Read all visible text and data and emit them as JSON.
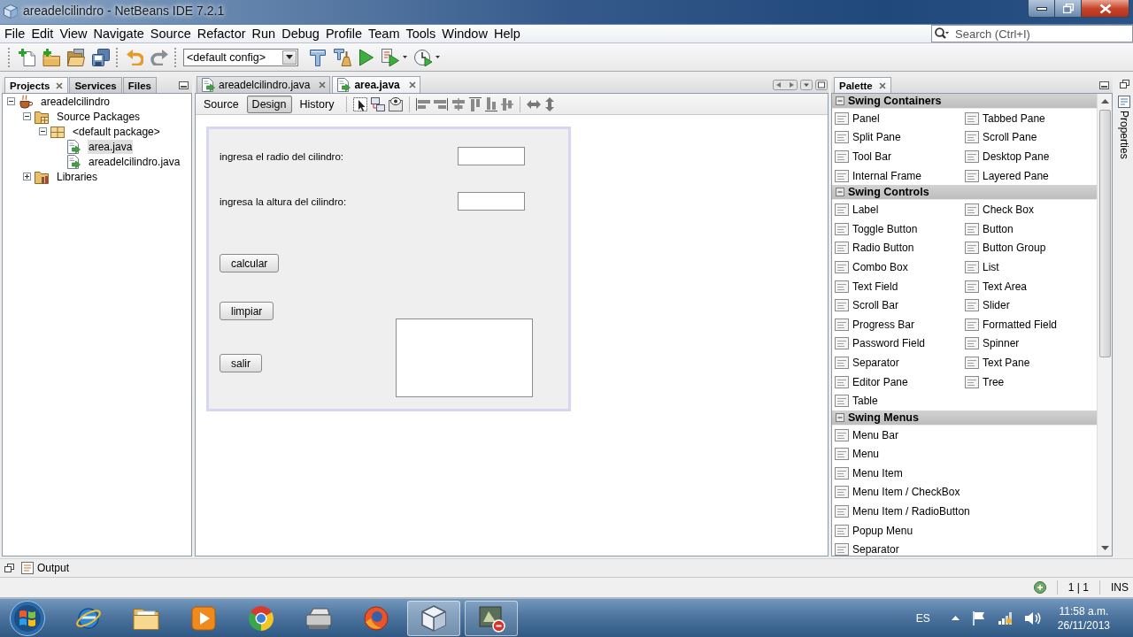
{
  "window": {
    "title": "areadelcilindro - NetBeans IDE 7.2.1"
  },
  "menu_bar": [
    "File",
    "Edit",
    "View",
    "Navigate",
    "Source",
    "Refactor",
    "Run",
    "Debug",
    "Profile",
    "Team",
    "Tools",
    "Window",
    "Help"
  ],
  "search": {
    "placeholder": "Search (Ctrl+I)"
  },
  "toolbar": {
    "configuration": "<default config>"
  },
  "projects_panel": {
    "tabs": [
      {
        "label": "Projects",
        "selected": true
      },
      {
        "label": "Services",
        "selected": false
      },
      {
        "label": "Files",
        "selected": false
      }
    ],
    "tree": [
      {
        "label": "areadelcilindro",
        "kind": "project",
        "expanded": true,
        "selected": false,
        "children": [
          {
            "label": "Source Packages",
            "kind": "sources",
            "expanded": true,
            "selected": false,
            "children": [
              {
                "label": "<default package>",
                "kind": "package",
                "expanded": true,
                "selected": false,
                "children": [
                  {
                    "label": "area.java",
                    "kind": "file",
                    "selected": true
                  },
                  {
                    "label": "areadelcilindro.java",
                    "kind": "file",
                    "selected": false
                  }
                ]
              }
            ]
          },
          {
            "label": "Libraries",
            "kind": "libraries",
            "expanded": false,
            "selected": false
          }
        ]
      }
    ]
  },
  "editor": {
    "tabs": [
      {
        "label": "areadelcilindro.java",
        "selected": false
      },
      {
        "label": "area.java",
        "selected": true
      }
    ],
    "views": [
      {
        "label": "Source",
        "selected": false
      },
      {
        "label": "Design",
        "selected": true
      },
      {
        "label": "History",
        "selected": false
      }
    ],
    "form": {
      "fields": [
        {
          "label": "ingresa el radio del cilindro:"
        },
        {
          "label": "ingresa la altura del cilindro:"
        }
      ],
      "buttons": [
        "calcular",
        "limpiar",
        "salir"
      ]
    }
  },
  "palette": {
    "title": "Palette",
    "sections": [
      {
        "label": "Swing Containers",
        "expanded": true,
        "items": [
          "Panel",
          "Tabbed Pane",
          "Split Pane",
          "Scroll Pane",
          "Tool Bar",
          "Desktop Pane",
          "Internal Frame",
          "Layered Pane"
        ]
      },
      {
        "label": "Swing Controls",
        "expanded": true,
        "items": [
          "Label",
          "Check Box",
          "Toggle Button",
          "Button",
          "Radio Button",
          "Button Group",
          "Combo Box",
          "List",
          "Text Field",
          "Text Area",
          "Scroll Bar",
          "Slider",
          "Progress Bar",
          "Formatted Field",
          "Password Field",
          "Spinner",
          "Separator",
          "Text Pane",
          "Editor Pane",
          "Tree",
          "Table"
        ]
      },
      {
        "label": "Swing Menus",
        "expanded": true,
        "items": [
          "Menu Bar",
          "Menu",
          "Menu Item",
          "Menu Item / CheckBox",
          "Menu Item / RadioButton",
          "Popup Menu",
          "Separator"
        ]
      }
    ]
  },
  "side_tabs": [
    {
      "label": "Properties"
    }
  ],
  "output_bar": {
    "label": "Output"
  },
  "status_bar": {
    "position": "1 | 1",
    "mode": "INS"
  },
  "taskbar": {
    "apps": [
      {
        "kind": "globe",
        "running": false,
        "active": false
      },
      {
        "kind": "folder",
        "running": false,
        "active": false
      },
      {
        "kind": "player",
        "running": false,
        "active": false
      },
      {
        "kind": "wheel",
        "running": false,
        "active": false
      },
      {
        "kind": "printer",
        "running": false,
        "active": false
      },
      {
        "kind": "flame",
        "running": false,
        "active": false
      },
      {
        "kind": "cube",
        "running": true,
        "active": true
      },
      {
        "kind": "tile",
        "running": true,
        "active": false
      }
    ],
    "language": "ES",
    "time": "11:58 a.m.",
    "date": "26/11/2013"
  }
}
